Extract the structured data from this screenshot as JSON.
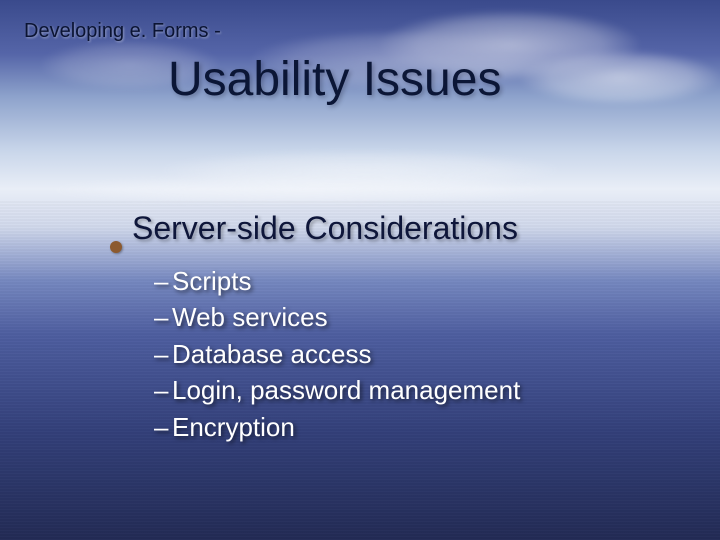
{
  "breadcrumb": "Developing e. Forms -",
  "title": "Usability Issues",
  "mainPoint": "Server-side Considerations",
  "subItems": [
    "Scripts",
    "Web services",
    "Database access",
    "Login, password management",
    "Encryption"
  ]
}
